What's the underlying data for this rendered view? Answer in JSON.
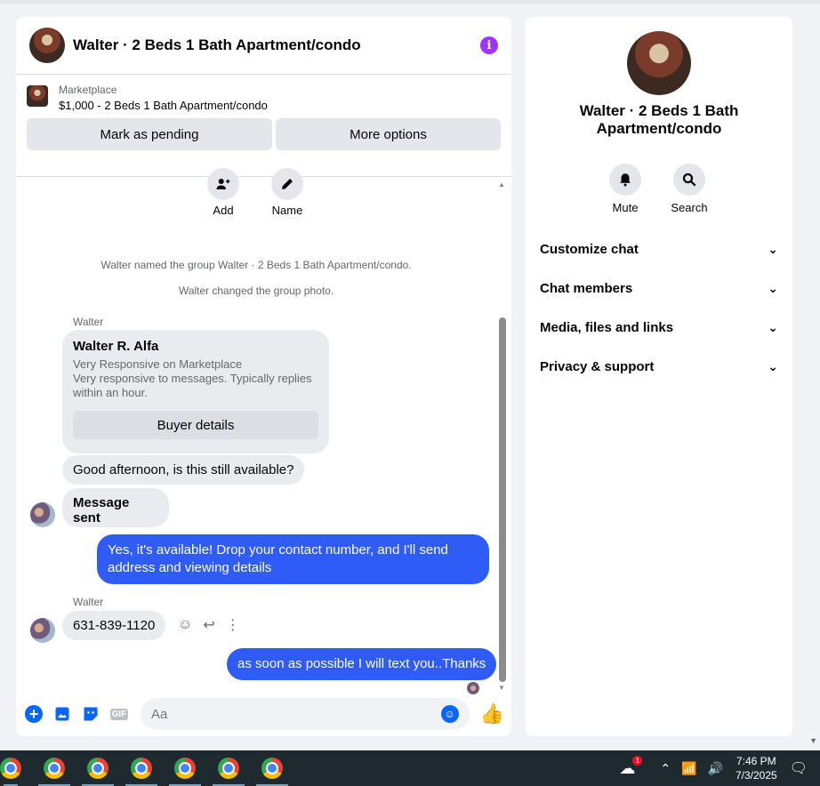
{
  "chat": {
    "title": "Walter · 2 Beds 1 Bath Apartment/condo",
    "marketplace": {
      "label": "Marketplace",
      "listing": "$1,000 - 2 Beds 1 Bath Apartment/condo",
      "mark_pending": "Mark as pending",
      "more_options": "More options"
    },
    "actions": {
      "add": "Add",
      "name": "Name"
    },
    "system_messages": [
      "Walter named the group Walter · 2 Beds 1 Bath Apartment/condo.",
      "Walter changed the group photo."
    ],
    "messages": {
      "sender_1": "Walter",
      "card_name": "Walter R. Alfa",
      "card_line1": "Very Responsive on Marketplace",
      "card_line2": "Very responsive to messages. Typically replies",
      "card_line3": "within an hour.",
      "card_button": "Buyer details",
      "msg_1": "Good afternoon, is this still available?",
      "msg_2": "Message sent",
      "msg_3": "Yes, it's available! Drop your contact number, and I'll send address and viewing details",
      "sender_2": "Walter",
      "msg_4": "631-839-1120",
      "msg_5": "as soon as possible I will text you..Thanks"
    },
    "composer": {
      "placeholder": "Aa",
      "gif_label": "GIF"
    }
  },
  "sidebar": {
    "title": "Walter · 2 Beds 1 Bath Apartment/condo",
    "mute": "Mute",
    "search": "Search",
    "sections": [
      "Customize chat",
      "Chat members",
      "Media, files and links",
      "Privacy & support"
    ]
  },
  "taskbar": {
    "time": "7:46 PM",
    "date": "7/3/2025",
    "badge": "1"
  }
}
